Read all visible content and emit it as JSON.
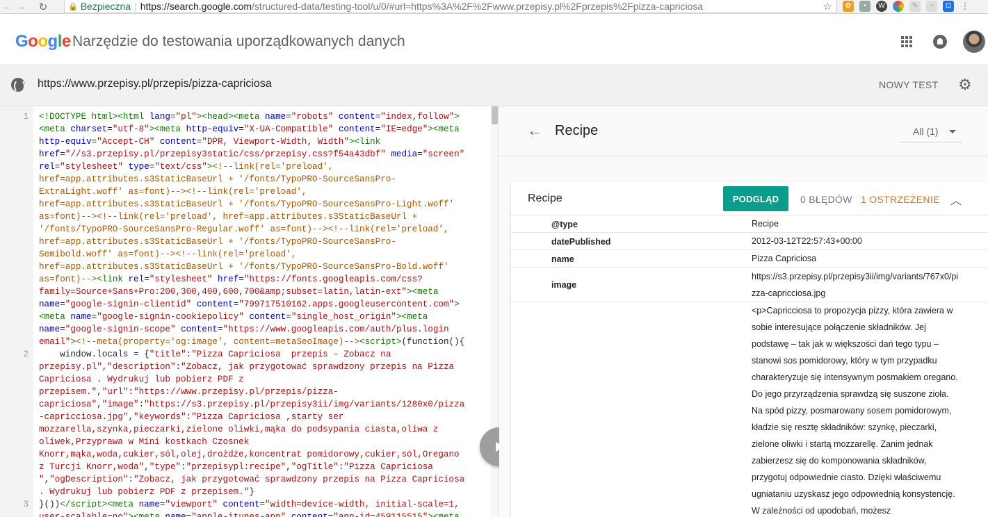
{
  "browser": {
    "secure_label": "Bezpieczna",
    "url_host": "https://search.google.com",
    "url_rest": "/structured-data/testing-tool/u/0/#url=https%3A%2F%2Fwww.przepisy.pl%2Fprzepis%2Fpizza-capriciosa"
  },
  "header": {
    "logo_letters": [
      "G",
      "o",
      "o",
      "g",
      "l",
      "e"
    ],
    "logo_colors": [
      "#4285f4",
      "#ea4335",
      "#fbbc05",
      "#4285f4",
      "#34a853",
      "#ea4335"
    ],
    "title": "Narzędzie do testowania uporządkowanych danych"
  },
  "url_bar": {
    "url": "https://www.przepisy.pl/przepis/pizza-capriciosa",
    "new_test_label": "NOWY TEST"
  },
  "code": {
    "line_numbers": [
      "1",
      "2",
      "3"
    ]
  },
  "results": {
    "title": "Recipe",
    "filter": "All (1)",
    "card": {
      "title": "Recipe",
      "preview_label": "PODGLĄD",
      "errors": "0 BŁĘDÓW",
      "warnings": "1 OSTRZEŻENIE"
    },
    "properties": [
      {
        "key": "@type",
        "value": "Recipe"
      },
      {
        "key": "datePublished",
        "value": "2012-03-12T22:57:43+00:00"
      },
      {
        "key": "name",
        "value": "Pizza Capriciosa"
      },
      {
        "key": "image",
        "value": "https://s3.przepisy.pl/przepisy3ii/img/variants/767x0/pizza-capricciosa.jpg"
      },
      {
        "key": "",
        "value": "<p>Capricciosa to propozycja pizzy, która zawiera w sobie interesujące połączenie składników. Jej podstawę – tak jak w większości dań tego typu – stanowi sos pomidorowy, który w tym przypadku charakteryzuje się intensywnym posmakiem oregano. Do jego przyrządzenia sprawdzą się suszone zioła. Na spód pizzy, posmarowany sosem pomidorowym, kładzie się resztę składników: szynkę, pieczarki, zielone oliwki i startą mozzarellę. Zanim jednak zabierzesz się do komponowania składników, przygotuj odpowiednie ciasto. Dzięki właściwemu ugniataniu uzyskasz jego odpowiednią konsystencję. W zależności od upodobań, możesz"
      }
    ]
  },
  "colors": {
    "accent_teal": "#0a9d8c",
    "warning_orange": "#e8710a",
    "secure_green": "#0b8043"
  }
}
